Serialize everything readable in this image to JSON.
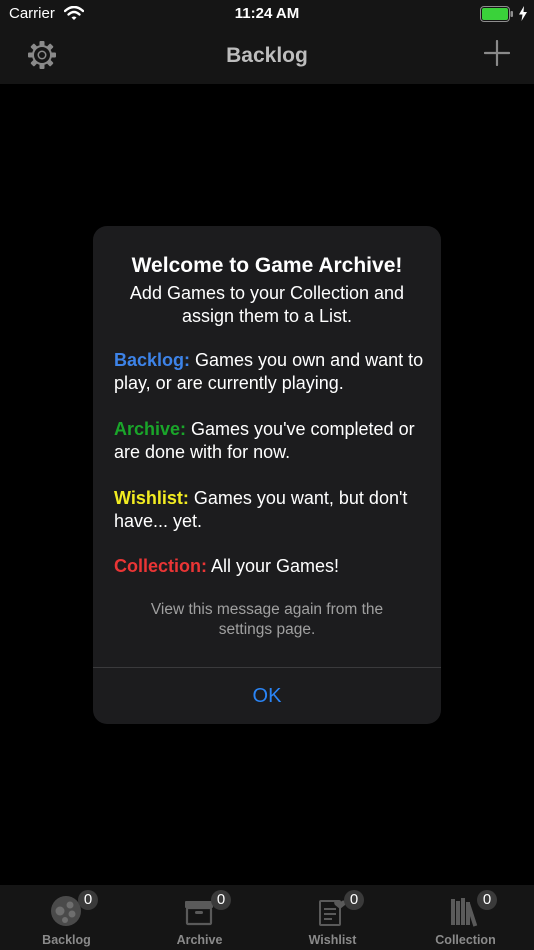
{
  "status_bar": {
    "carrier": "Carrier",
    "time": "11:24 AM"
  },
  "nav": {
    "title": "Backlog",
    "left_icon": "gear-icon",
    "right_icon": "plus-icon"
  },
  "dialog": {
    "title": "Welcome to Game Archive!",
    "intro": "Add Games to your Collection and assign them to a List.",
    "items": [
      {
        "label": "Backlog:",
        "text": " Games you own and want to play, or are currently playing.",
        "color": "#3d83e8"
      },
      {
        "label": "Archive:",
        "text": " Games you've completed or are done with for now.",
        "color": "#1aa52a"
      },
      {
        "label": "Wishlist:",
        "text": " Games you want, but don't have... yet.",
        "color": "#f2ec21"
      },
      {
        "label": "Collection:",
        "text": " All your Games!",
        "color": "#ea3535"
      }
    ],
    "note": "View this message again from the settings page.",
    "ok_label": "OK"
  },
  "tabs": [
    {
      "label": "Backlog",
      "badge": "0",
      "icon": "controller-icon"
    },
    {
      "label": "Archive",
      "badge": "0",
      "icon": "archive-box-icon"
    },
    {
      "label": "Wishlist",
      "badge": "0",
      "icon": "wishlist-icon"
    },
    {
      "label": "Collection",
      "badge": "0",
      "icon": "books-icon"
    }
  ]
}
